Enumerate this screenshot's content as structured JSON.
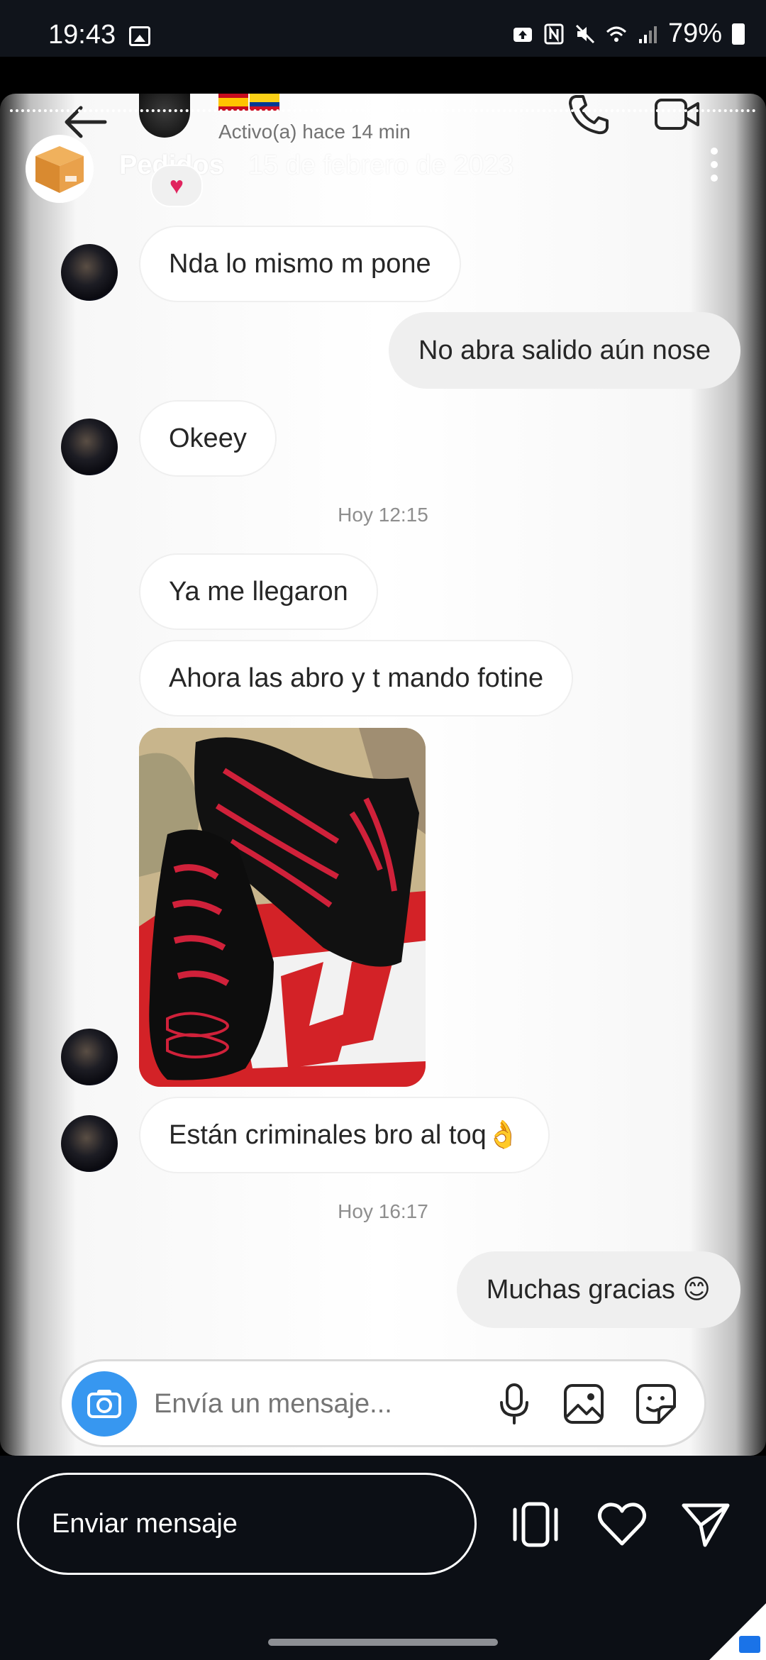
{
  "status_bar": {
    "time": "19:43",
    "battery": "79%",
    "icons": [
      "image-icon",
      "upload-icon",
      "nfc-icon",
      "mute-icon",
      "wifi-icon",
      "signal-icon",
      "battery-icon"
    ]
  },
  "chat": {
    "active_status": "Activo(a) hace 14 min",
    "flags": [
      "spain-flag",
      "colombia-flag"
    ],
    "reaction": "♥"
  },
  "story": {
    "owner": "Pedidos",
    "date": "15 de febrero de 2023"
  },
  "messages": [
    {
      "text": "Nda lo mismo m pone",
      "direction": "in"
    },
    {
      "text": "No abra salido aún nose",
      "direction": "out"
    },
    {
      "text": "Okeey",
      "direction": "in"
    },
    {
      "timestamp": "Hoy 12:15"
    },
    {
      "text": "Ya me llegaron",
      "direction": "in"
    },
    {
      "text": "Ahora las abro y t mando fotine",
      "direction": "in"
    },
    {
      "image": "photo of black and red sneakers on a red shoe box",
      "direction": "in"
    },
    {
      "text": "Están criminales bro al toq👌",
      "direction": "in"
    },
    {
      "timestamp": "Hoy 16:17"
    },
    {
      "text": "Muchas gracias 😊",
      "direction": "out"
    }
  ],
  "composer": {
    "placeholder": "Envía un mensaje..."
  },
  "story_reply": {
    "placeholder": "Enviar mensaje"
  },
  "colors": {
    "accent_blue": "#3797f0",
    "bubble_out": "#efefef",
    "bubble_in": "#ffffff",
    "text": "#262626",
    "muted": "#8e8e8e",
    "bar": "#0c0f15"
  }
}
